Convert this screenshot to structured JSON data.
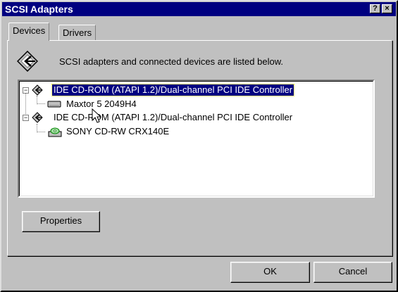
{
  "window": {
    "title": "SCSI Adapters",
    "help_glyph": "?",
    "close_glyph": "×"
  },
  "tabs": [
    {
      "label": "Devices",
      "active": true
    },
    {
      "label": "Drivers",
      "active": false
    }
  ],
  "info": {
    "icon": "scsi-adapter-icon",
    "text": "SCSI adapters and connected devices are listed below."
  },
  "tree": {
    "nodes": [
      {
        "label": "IDE CD-ROM (ATAPI 1.2)/Dual-channel PCI IDE Controller",
        "level": 0,
        "expander": "−",
        "icon": "scsi-adapter-icon",
        "selected": true
      },
      {
        "label": "Maxtor 5 2049H4",
        "level": 1,
        "icon": "hard-drive-icon",
        "selected": false
      },
      {
        "label": "IDE CD-ROM (ATAPI 1.2)/Dual-channel PCI IDE Controller",
        "level": 0,
        "expander": "−",
        "icon": "scsi-adapter-icon",
        "selected": false
      },
      {
        "label": "SONY CD-RW  CRX140E",
        "level": 1,
        "icon": "cd-drive-icon",
        "selected": false
      }
    ]
  },
  "buttons": {
    "properties": "Properties",
    "ok": "OK",
    "cancel": "Cancel"
  },
  "colors": {
    "titlebar": "#000080",
    "face": "#c0c0c0",
    "selection": "#000080"
  }
}
